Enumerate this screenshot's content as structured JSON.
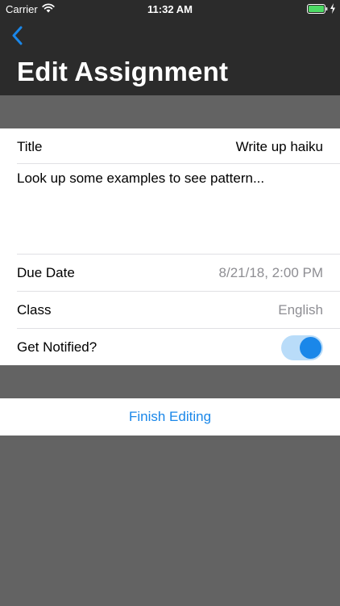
{
  "status_bar": {
    "carrier": "Carrier",
    "time": "11:32 AM"
  },
  "nav": {
    "title": "Edit Assignment"
  },
  "form": {
    "title_label": "Title",
    "title_value": "Write up haiku",
    "notes": "Look up some examples to see pattern...",
    "due_label": "Due Date",
    "due_value": "8/21/18, 2:00 PM",
    "class_label": "Class",
    "class_value": "English",
    "notify_label": "Get Notified?",
    "notify_on": true
  },
  "actions": {
    "finish_label": "Finish Editing"
  },
  "colors": {
    "accent": "#1a87e9",
    "toggle_track": "#b9dcf9",
    "header_bg": "#2b2b2b",
    "backdrop": "#636363",
    "battery": "#4cd964"
  },
  "icons": {
    "wifi": "wifi-icon",
    "battery": "battery-icon",
    "charging": "charging-bolt-icon",
    "back": "chevron-left-icon"
  }
}
